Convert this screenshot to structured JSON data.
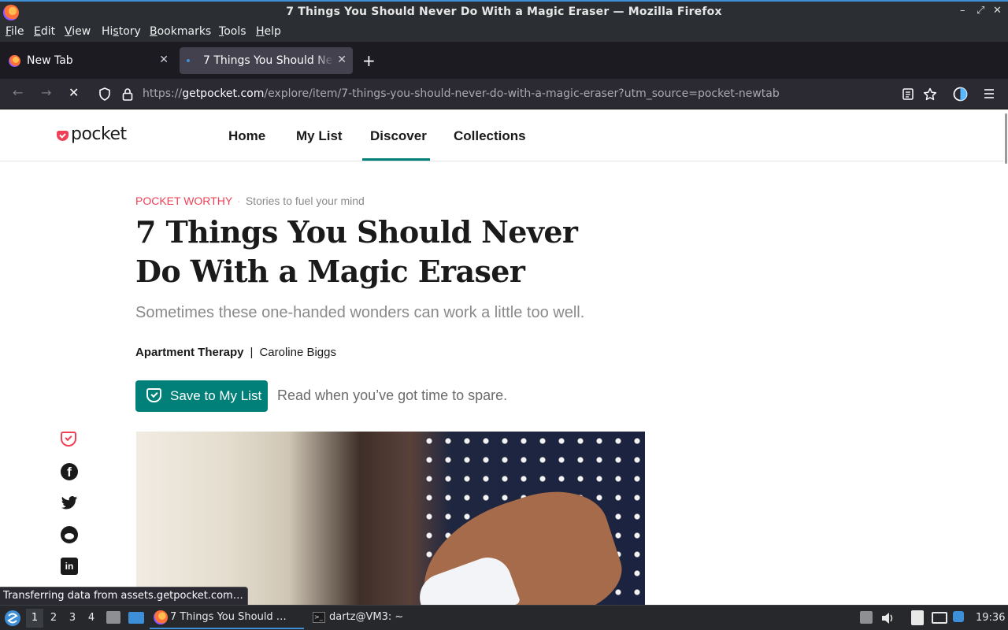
{
  "window": {
    "title": "7 Things You Should Never Do With a Magic Eraser — Mozilla Firefox",
    "controls": [
      "–",
      "⤢",
      "✕"
    ]
  },
  "menubar": {
    "items": [
      {
        "label": "File",
        "u": "F",
        "rest": "ile"
      },
      {
        "label": "Edit",
        "u": "E",
        "rest": "dit"
      },
      {
        "label": "View",
        "u": "V",
        "rest": "iew"
      },
      {
        "label": "History",
        "pre": "Hi",
        "u": "s",
        "rest": "tory"
      },
      {
        "label": "Bookmarks",
        "u": "B",
        "rest": "ookmarks"
      },
      {
        "label": "Tools",
        "u": "T",
        "rest": "ools"
      },
      {
        "label": "Help",
        "u": "H",
        "rest": "elp"
      }
    ]
  },
  "tabs": [
    {
      "label": "New Tab",
      "active": false
    },
    {
      "label": "7 Things You Should Never Do With a Magic Eraser",
      "active": true
    }
  ],
  "newtab_symbol": "+",
  "nav": {
    "back": "←",
    "forward": "→",
    "stop": "✕",
    "url_prefix": "https://",
    "url_domain": "getpocket.com",
    "url_path": "/explore/item/7-things-you-should-never-do-with-a-magic-eraser?utm_source=pocket-newtab"
  },
  "site": {
    "logo_text": "pocket",
    "nav_links": [
      "Home",
      "My List",
      "Discover",
      "Collections"
    ],
    "active_nav": "Discover"
  },
  "article": {
    "kicker": "POCKET WORTHY",
    "dot": "·",
    "tagline": "Stories to fuel your mind",
    "title": "7 Things You Should Never Do With a Magic Eraser",
    "dek": "Sometimes these one-handed wonders can work a little too well.",
    "publisher": "Apartment Therapy",
    "separator": "|",
    "author": "Caroline Biggs",
    "save_label": "Save to My List",
    "save_note": "Read when you’ve got time to spare."
  },
  "share": {
    "facebook_glyph": "f",
    "linkedin_glyph": "in"
  },
  "status_text": "Transferring data from assets.getpocket.com…",
  "taskbar": {
    "workspaces": [
      "1",
      "2",
      "3",
      "4"
    ],
    "active_workspace": "1",
    "tasks": [
      {
        "label": "7 Things You Should …",
        "active": true
      },
      {
        "label": "dartz@VM3: ~",
        "active": false
      }
    ],
    "clock": "19:36"
  }
}
